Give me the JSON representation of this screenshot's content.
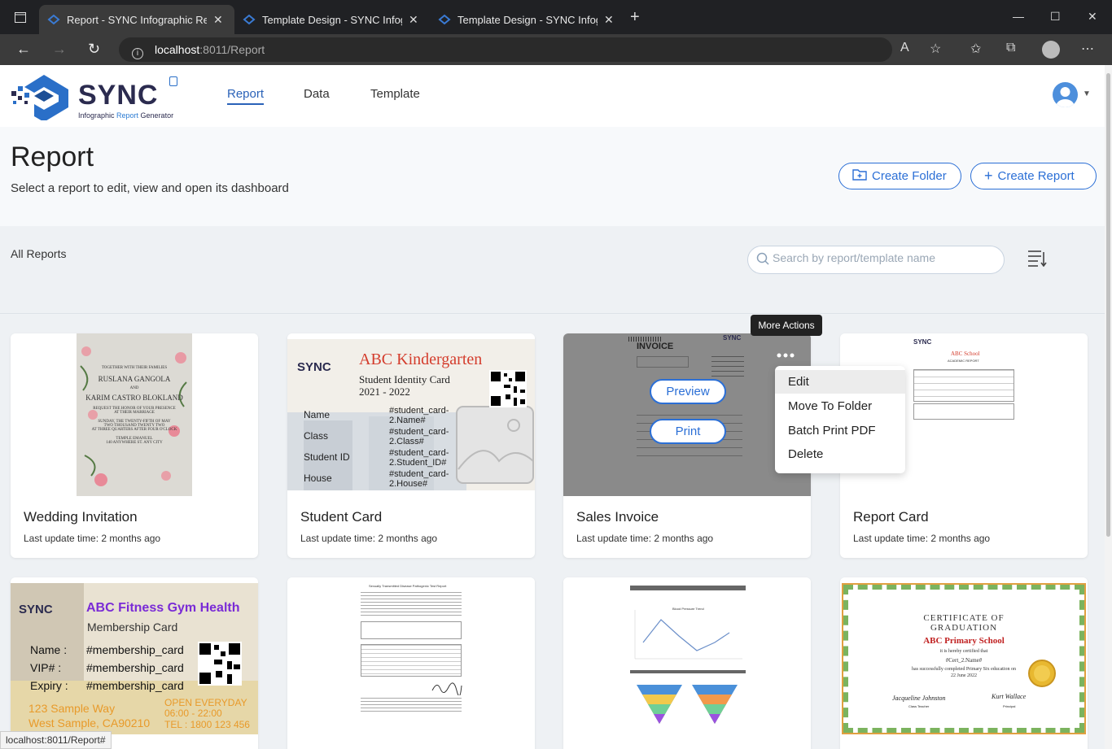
{
  "browser": {
    "tabs": [
      {
        "title": "Report - SYNC Infographic Report Generator"
      },
      {
        "title": "Template Design - SYNC Infographic Report Generator"
      },
      {
        "title": "Template Design - SYNC Infographic Report Generator"
      }
    ],
    "url_host": "localhost",
    "url_path": ":8011/Report"
  },
  "app": {
    "logo_text": "SYNC",
    "logo_sub_1": "Infographic ",
    "logo_sub_2": "Report",
    "logo_sub_3": " Generator",
    "nav": [
      {
        "label": "Report"
      },
      {
        "label": "Data"
      },
      {
        "label": "Template"
      }
    ]
  },
  "page": {
    "title": "Report",
    "subtitle": "Select a report to edit, view and open its dashboard",
    "create_folder": "Create Folder",
    "create_report": "Create Report",
    "all_reports": "All Reports",
    "search_placeholder": "Search by report/template name"
  },
  "cards": [
    {
      "name": "Wedding Invitation",
      "updated": "Last update time: 2 months ago"
    },
    {
      "name": "Student Card",
      "updated": "Last update time: 2 months ago"
    },
    {
      "name": "Sales Invoice",
      "updated": "Last update time: 2 months ago"
    },
    {
      "name": "Report Card",
      "updated": "Last update time: 2 months ago"
    }
  ],
  "thumbs": {
    "wedding": [
      "TOGETHER WITH THEIR FAMILIES",
      "RUSLANA GANGOLA",
      "AND",
      "KARIM CASTRO BLOKLAND",
      "REQUEST THE HONOR OF YOUR PRESENCE",
      "AT THEIR MARRIAGE",
      "SUNDAY, THE TWENTY-FIFTH OF MAY",
      "TWO THOUSAND TWENTY TWO",
      "AT THREE QUARTERS AFTER FOUR O'CLOCK",
      "TEMPLE EMANUEL",
      "140 ANYWHERE ST. ANY CITY"
    ],
    "student": {
      "logo": "SYNC",
      "school": "ABC Kindergarten",
      "card_title": "Student Identity Card",
      "year": "2021 - 2022",
      "fields": [
        "Name",
        "Class",
        "Student ID",
        "House"
      ],
      "values": [
        "#student_card-2.Name#",
        "#student_card-2.Class#",
        "#student_card-2.Student_ID#",
        "#student_card-2.House#"
      ]
    },
    "invoice": {
      "title": "INVOICE",
      "logo": "SYNC"
    },
    "reportcard": {
      "logo": "SYNC",
      "school": "ABC School",
      "subtitle": "ACADEMIC REPORT"
    },
    "gym": {
      "logo": "SYNC",
      "title": "ABC Fitness Gym Health",
      "subtitle": "Membership Card",
      "fields": [
        "Name :",
        "VIP# :",
        "Expiry :"
      ],
      "values": [
        "#membership_card",
        "#membership_card",
        "#membership_card"
      ],
      "address_1": "123 Sample Way",
      "address_2": "West Sample, CA90210",
      "hours_1": "OPEN EVERYDAY",
      "hours_2": "06:00 - 22:00",
      "tel": "TEL : 1800 123 456"
    },
    "lab": {
      "title": "Sexually Transmitted Disease Pathogenic Test Report"
    },
    "chart": {
      "title": "Blood Pressure Trend"
    },
    "cert": {
      "title_1": "Certificate of",
      "title_2": "Graduation",
      "school": "ABC Primary School",
      "line_1": "it is hereby certified that",
      "name": "#Cert_2.Name#",
      "line_2": "has successfully completed Primary Six education on",
      "date": "22 June 2022",
      "sig_1": "Jacqueline Johnston",
      "sig_1_role": "Class Teacher",
      "sig_2": "Kurt Wallace",
      "sig_2_role": "Principal"
    }
  },
  "menu": {
    "tooltip": "More Actions",
    "items": [
      {
        "label": "Edit"
      },
      {
        "label": "Move To Folder"
      },
      {
        "label": "Batch Print PDF"
      },
      {
        "label": "Delete"
      }
    ],
    "preview": "Preview",
    "print": "Print"
  },
  "status_url": "localhost:8011/Report#"
}
